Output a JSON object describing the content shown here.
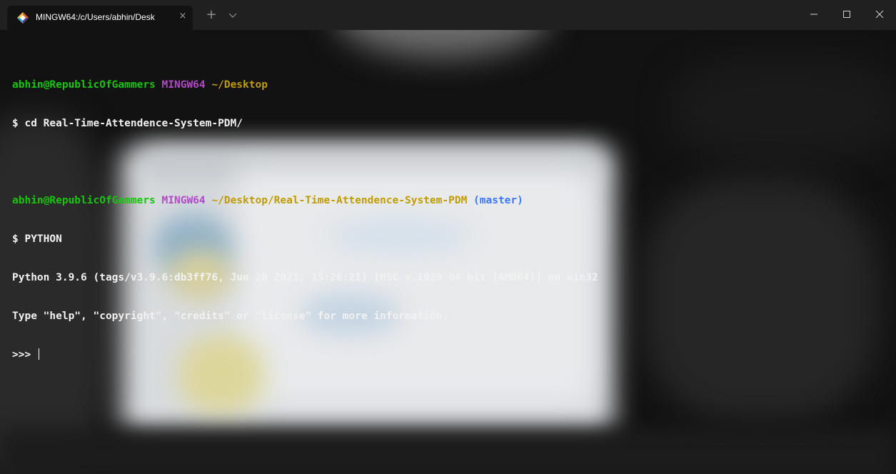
{
  "window": {
    "tab_title": "MINGW64:/c/Users/abhin/Desk",
    "tab_icon": "git-bash-icon",
    "new_tab_symbol": "+",
    "close_symbol": "×"
  },
  "terminal": {
    "prompt1": {
      "user_host": "abhin@RepublicOfGammers",
      "system": "MINGW64",
      "path": "~/Desktop"
    },
    "command1": "$ cd Real-Time-Attendence-System-PDM/",
    "prompt2": {
      "user_host": "abhin@RepublicOfGammers",
      "system": "MINGW64",
      "path": "~/Desktop/Real-Time-Attendence-System-PDM",
      "branch": "(master)"
    },
    "command2": "$ PYTHON",
    "output1": "Python 3.9.6 (tags/v3.9.6:db3ff76, Jun 28 2021, 15:26:21) [MSC v.1929 64 bit (AMD64)] on win32",
    "output2": "Type \"help\", \"copyright\", \"credits\" or \"license\" for more information.",
    "repl_prompt": ">>>"
  },
  "colors": {
    "user_host": "#16c60c",
    "system": "#b148c6",
    "path": "#c19c00",
    "branch": "#3b78ff",
    "text": "#f2f2f2"
  }
}
